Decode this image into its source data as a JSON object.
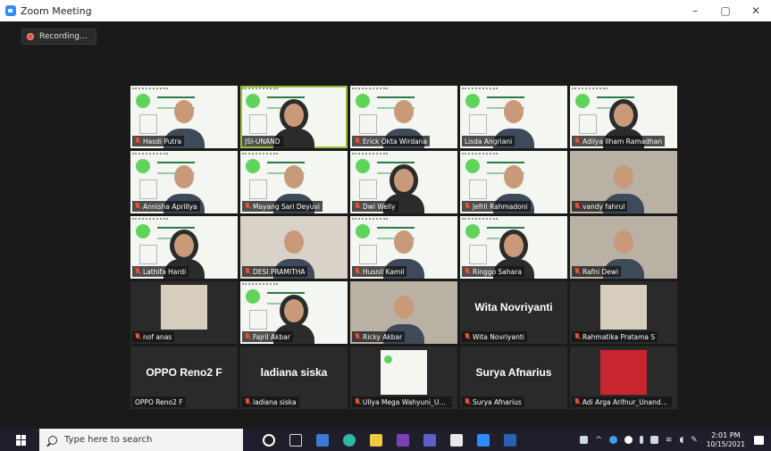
{
  "window": {
    "title": "Zoom Meeting",
    "controls": {
      "minimize": "–",
      "maximize": "▢",
      "close": "✕"
    }
  },
  "meeting": {
    "recording_label": "Recording...",
    "participants": [
      {
        "name": "Hasdi Putra",
        "muted": true,
        "kind": "slide"
      },
      {
        "name": "JSI-UNAND",
        "muted": false,
        "kind": "slide",
        "active": true
      },
      {
        "name": "Erick Okta Wirdana",
        "muted": true,
        "kind": "slide"
      },
      {
        "name": "Lisda Angriani",
        "muted": false,
        "kind": "slide"
      },
      {
        "name": "Adilya Ilham Ramadhan",
        "muted": true,
        "kind": "slide"
      },
      {
        "name": "Annisha Aprillya",
        "muted": true,
        "kind": "slide"
      },
      {
        "name": "Mayang Sari Deyuvi",
        "muted": true,
        "kind": "slide"
      },
      {
        "name": "Dwi Welly",
        "muted": true,
        "kind": "slide"
      },
      {
        "name": "Jefril Rahmadoni",
        "muted": true,
        "kind": "slide"
      },
      {
        "name": "vandy fahrul",
        "muted": true,
        "kind": "room"
      },
      {
        "name": "Lathifa Hardi",
        "muted": true,
        "kind": "slide"
      },
      {
        "name": "DESI PRAMITHA",
        "muted": true,
        "kind": "photo"
      },
      {
        "name": "Husnil Kamil",
        "muted": true,
        "kind": "slide"
      },
      {
        "name": "Ringgo Sahara",
        "muted": true,
        "kind": "slide"
      },
      {
        "name": "Rafni Dewi",
        "muted": true,
        "kind": "room"
      },
      {
        "name": "nof anas",
        "muted": true,
        "kind": "mini-photo"
      },
      {
        "name": "Fajril Akbar",
        "muted": true,
        "kind": "slide"
      },
      {
        "name": "Ricky Akbar",
        "muted": true,
        "kind": "room"
      },
      {
        "name": "Wita Novriyanti",
        "muted": true,
        "kind": "text",
        "display": "Wita Novriyanti"
      },
      {
        "name": "Rahmatika Pratama S",
        "muted": true,
        "kind": "mini-photo"
      },
      {
        "name": "OPPO Reno2 F",
        "muted": false,
        "kind": "text",
        "display": "OPPO Reno2 F"
      },
      {
        "name": "ladiana siska",
        "muted": true,
        "kind": "text",
        "display": "ladiana siska"
      },
      {
        "name": "Ullya Mega Wahyuni_Uni...",
        "muted": true,
        "kind": "mini-slide"
      },
      {
        "name": "Surya Afnarius",
        "muted": true,
        "kind": "text",
        "display": "Surya Afnarius"
      },
      {
        "name": "Adi Arga Arifnur_Unand_...",
        "muted": true,
        "kind": "mini-red"
      }
    ]
  },
  "taskbar": {
    "search_placeholder": "Type here to search",
    "time": "2:01 PM",
    "date": "10/15/2021"
  },
  "colors": {
    "accent_active": "#9ac03a",
    "muted_icon": "#e8503a",
    "zoom_blue": "#2d8cff"
  }
}
